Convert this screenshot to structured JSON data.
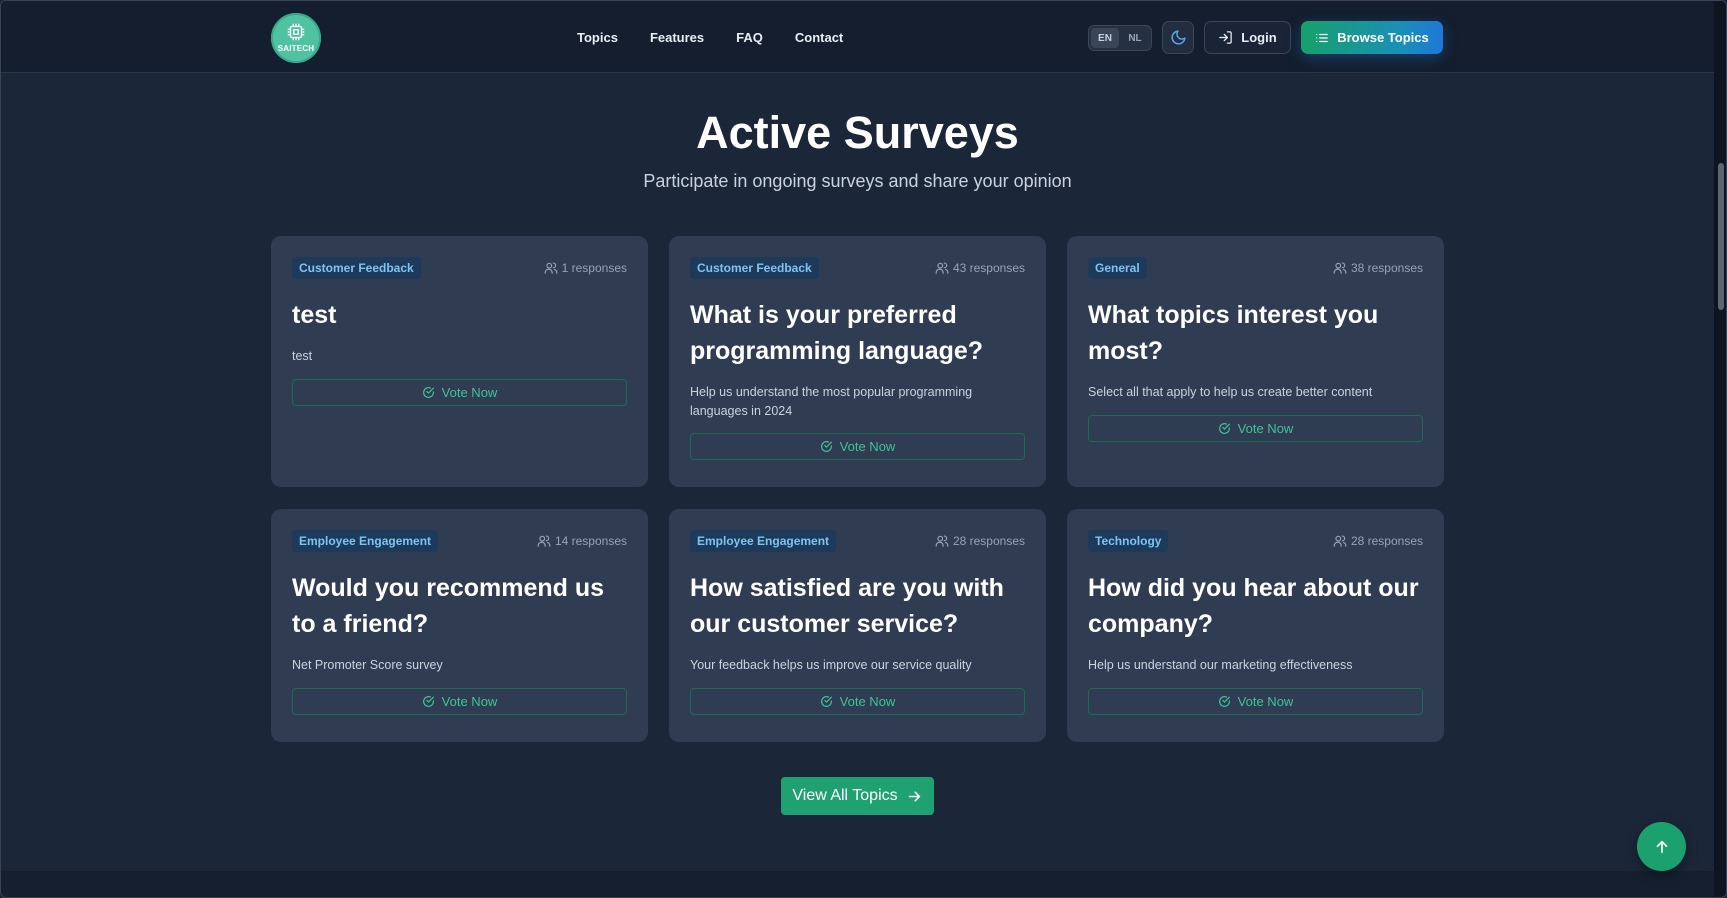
{
  "header": {
    "logo_text": "SAITECH",
    "nav": [
      "Topics",
      "Features",
      "FAQ",
      "Contact"
    ],
    "lang": [
      "EN",
      "NL"
    ],
    "login_label": "Login",
    "browse_label": "Browse Topics"
  },
  "main": {
    "title": "Active Surveys",
    "subtitle": "Participate in ongoing surveys and share your opinion",
    "surveys": [
      {
        "category": "Customer Feedback",
        "responses": "1 responses",
        "title": "test",
        "description": "test",
        "vote": "Vote Now"
      },
      {
        "category": "Customer Feedback",
        "responses": "43 responses",
        "title": "What is your preferred programming language?",
        "description": "Help us understand the most popular programming languages in 2024",
        "vote": "Vote Now"
      },
      {
        "category": "General",
        "responses": "38 responses",
        "title": "What topics interest you most?",
        "description": "Select all that apply to help us create better content",
        "vote": "Vote Now"
      },
      {
        "category": "Employee Engagement",
        "responses": "14 responses",
        "title": "Would you recommend us to a friend?",
        "description": "Net Promoter Score survey",
        "vote": "Vote Now"
      },
      {
        "category": "Employee Engagement",
        "responses": "28 responses",
        "title": "How satisfied are you with our customer service?",
        "description": "Your feedback helps us improve our service quality",
        "vote": "Vote Now"
      },
      {
        "category": "Technology",
        "responses": "28 responses",
        "title": "How did you hear about our company?",
        "description": "Help us understand our marketing effectiveness",
        "vote": "Vote Now"
      }
    ],
    "view_all_label": "View All Topics"
  },
  "colors": {
    "accent": "#1fa172",
    "badge_text": "#7fc4f0",
    "card_bg": "#2f3c51"
  },
  "icons": {
    "theme": "moon-icon",
    "login": "login-icon",
    "browse": "list-icon",
    "responses": "users-icon",
    "vote": "check-circle-icon",
    "view_all": "arrow-right-icon",
    "scroll_top": "arrow-up-icon"
  }
}
